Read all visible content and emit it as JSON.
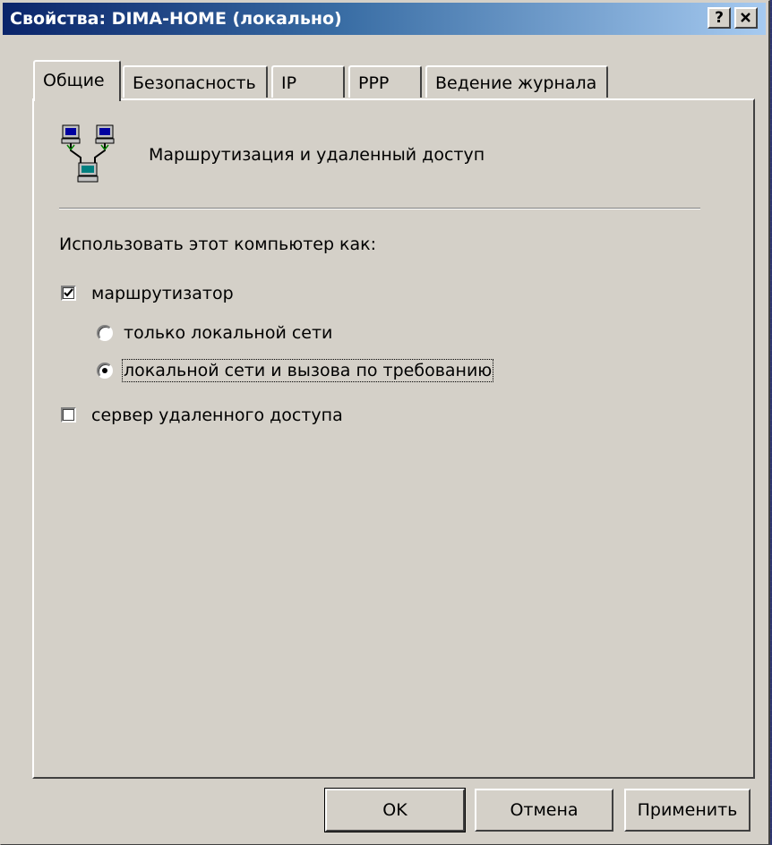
{
  "dialog": {
    "title": "Свойства: DIMA-HOME (локально)",
    "help_label": "?",
    "close_label": "×"
  },
  "tabs": [
    {
      "label": "Общие",
      "active": true
    },
    {
      "label": "Безопасность",
      "active": false
    },
    {
      "label": "IP",
      "active": false
    },
    {
      "label": "PPP",
      "active": false
    },
    {
      "label": "Ведение журнала",
      "active": false
    }
  ],
  "general": {
    "service_name": "Маршрутизация и удаленный доступ",
    "icon": "network-computers-icon",
    "use_as_label": "Использовать этот компьютер как:",
    "router": {
      "label": "маршрутизатор",
      "checked": true
    },
    "lan_only": {
      "label": "только локальной сети",
      "selected": false
    },
    "lan_and_dial": {
      "label": "локальной сети и вызова по требованию",
      "selected": true
    },
    "ras_server": {
      "label": "сервер удаленного доступа",
      "checked": false
    }
  },
  "buttons": {
    "ok": "OK",
    "cancel": "Отмена",
    "apply": "Применить"
  },
  "colors": {
    "background": "#2e3670",
    "titlebar_start": "#0a246a",
    "titlebar_end": "#a6caf0",
    "face": "#d4d0c8"
  }
}
